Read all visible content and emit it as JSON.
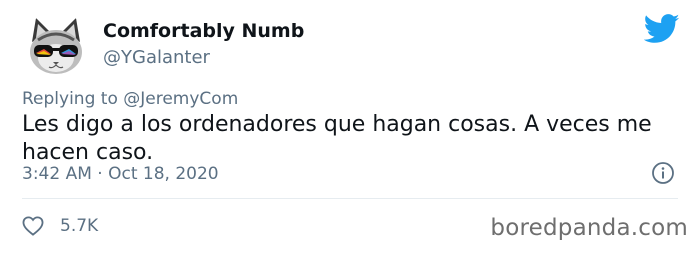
{
  "tweet": {
    "author": {
      "display_name": "Comfortably Numb",
      "handle": "@YGalanter"
    },
    "reply_prefix": "Replying to",
    "reply_to": "@JeremyCom",
    "text": "Les digo a los ordenadores que hagan cosas. A veces me hacen caso.",
    "timestamp": "3:42 AM · Oct 18, 2020",
    "likes": "5.7K"
  },
  "icons": {
    "brand": "twitter-bird-icon",
    "info": "info-icon",
    "like": "heart-icon"
  },
  "colors": {
    "brand_blue": "#1da1f2",
    "secondary_text": "#5b7083",
    "primary_text": "#0f1419"
  },
  "watermark": "boredpanda.com"
}
